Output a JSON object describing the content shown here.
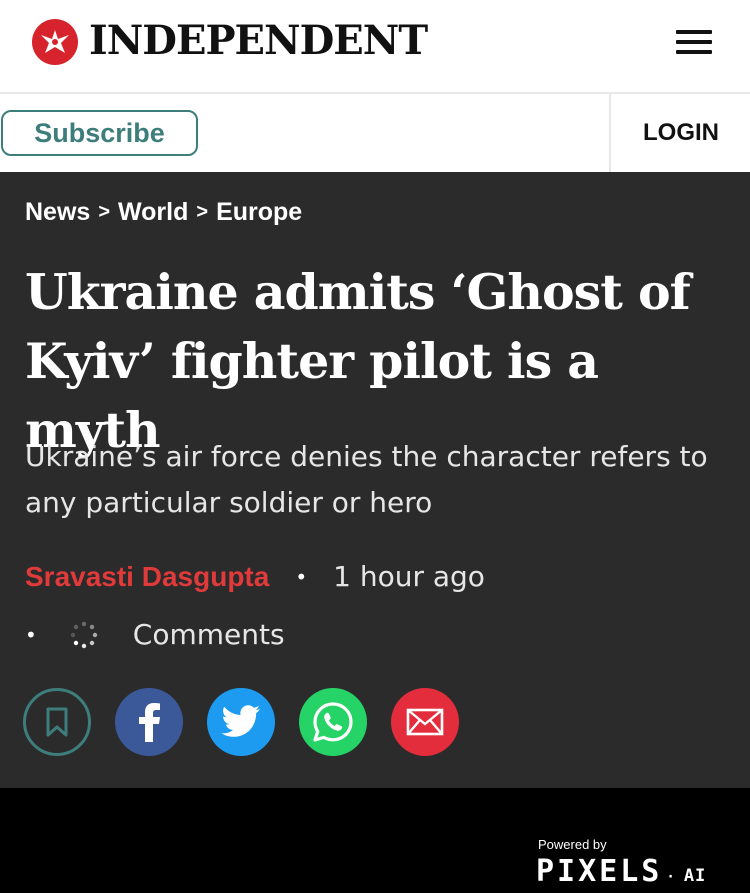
{
  "header": {
    "logo_text": "INDEPENDENT",
    "logo_icon": "eagle-icon",
    "menu_icon": "hamburger-menu-icon"
  },
  "subbar": {
    "subscribe_label": "Subscribe",
    "login_label": "LOGIN"
  },
  "breadcrumb": {
    "items": [
      "News",
      "World",
      "Europe"
    ],
    "separator": ">"
  },
  "article": {
    "headline": "Ukraine admits ‘Ghost of Kyiv’ fighter pilot is a myth",
    "standfirst": "Ukraine’s air force denies the character refers to any particular soldier or hero",
    "author": "Sravasti Dasgupta",
    "timestamp": "1 hour ago",
    "comments_label": "Comments"
  },
  "share": {
    "buttons": [
      "bookmark-icon",
      "facebook-icon",
      "twitter-icon",
      "whatsapp-icon",
      "email-icon"
    ]
  },
  "footer": {
    "powered_by": "Powered by",
    "brand": "PIXELS",
    "brand_suffix": "AI"
  },
  "colors": {
    "accent_red": "#e03a3a",
    "teal": "#3d7e7c",
    "article_bg": "#2b2b2b",
    "facebook": "#3b5998",
    "twitter": "#1d9bf0",
    "whatsapp": "#25d366",
    "email": "#e32d3c"
  }
}
